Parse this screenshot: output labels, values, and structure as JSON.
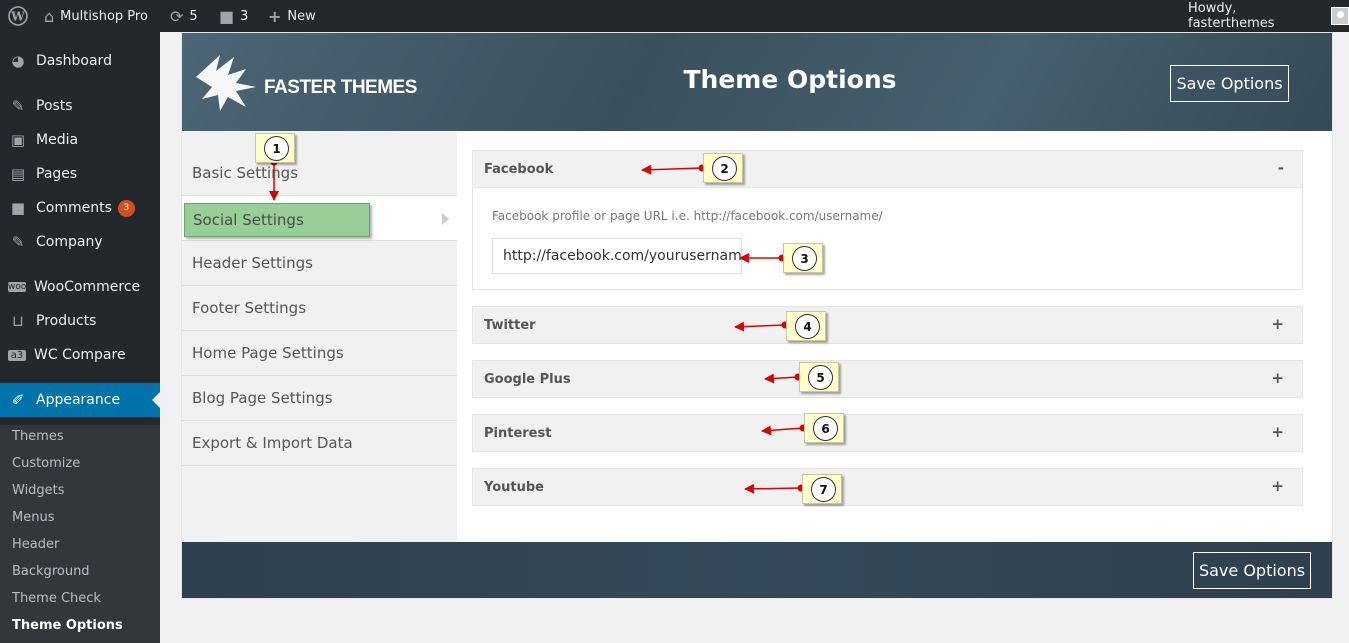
{
  "adminbar": {
    "site_name": "Multishop Pro",
    "updates": "5",
    "comments": "3",
    "new_label": "New",
    "greeting": "Howdy, fasterthemes"
  },
  "sidebar": {
    "items": [
      {
        "label": "Dashboard",
        "icon": "dashboard-icon"
      },
      {
        "label": "Posts",
        "icon": "pin-icon"
      },
      {
        "label": "Media",
        "icon": "media-icon"
      },
      {
        "label": "Pages",
        "icon": "pages-icon"
      },
      {
        "label": "Comments",
        "icon": "comment-icon",
        "badge": "3"
      },
      {
        "label": "Company",
        "icon": "pin-icon"
      },
      {
        "label": "WooCommerce",
        "icon": "woo-icon"
      },
      {
        "label": "Products",
        "icon": "cart-icon"
      },
      {
        "label": "WC Compare",
        "icon": "a3-icon"
      },
      {
        "label": "Appearance",
        "icon": "brush-icon"
      }
    ],
    "submenu": [
      "Themes",
      "Customize",
      "Widgets",
      "Menus",
      "Header",
      "Background",
      "Theme Check",
      "Theme Options"
    ]
  },
  "header": {
    "brand": "FASTER THEMES",
    "title": "Theme Options",
    "save_label": "Save Options"
  },
  "settings_nav": [
    "Basic Settings",
    "Social Settings",
    "Header Settings",
    "Footer Settings",
    "Home Page Settings",
    "Blog Page Settings",
    "Export & Import Data"
  ],
  "sections": [
    {
      "title": "Facebook",
      "toggle": "-",
      "description": "Facebook profile or page URL i.e. http://facebook.com/username/",
      "value": "http://facebook.com/yourusername"
    },
    {
      "title": "Twitter",
      "toggle": "+"
    },
    {
      "title": "Google Plus",
      "toggle": "+"
    },
    {
      "title": "Pinterest",
      "toggle": "+"
    },
    {
      "title": "Youtube",
      "toggle": "+"
    }
  ],
  "footer": {
    "save_label": "Save Options"
  },
  "callouts": [
    "1",
    "2",
    "3",
    "4",
    "5",
    "6",
    "7"
  ],
  "colors": {
    "accent": "#0073aa",
    "adminbar": "#23282d",
    "annotation_arrow": "#e00000",
    "highlight": "#97cf97"
  }
}
